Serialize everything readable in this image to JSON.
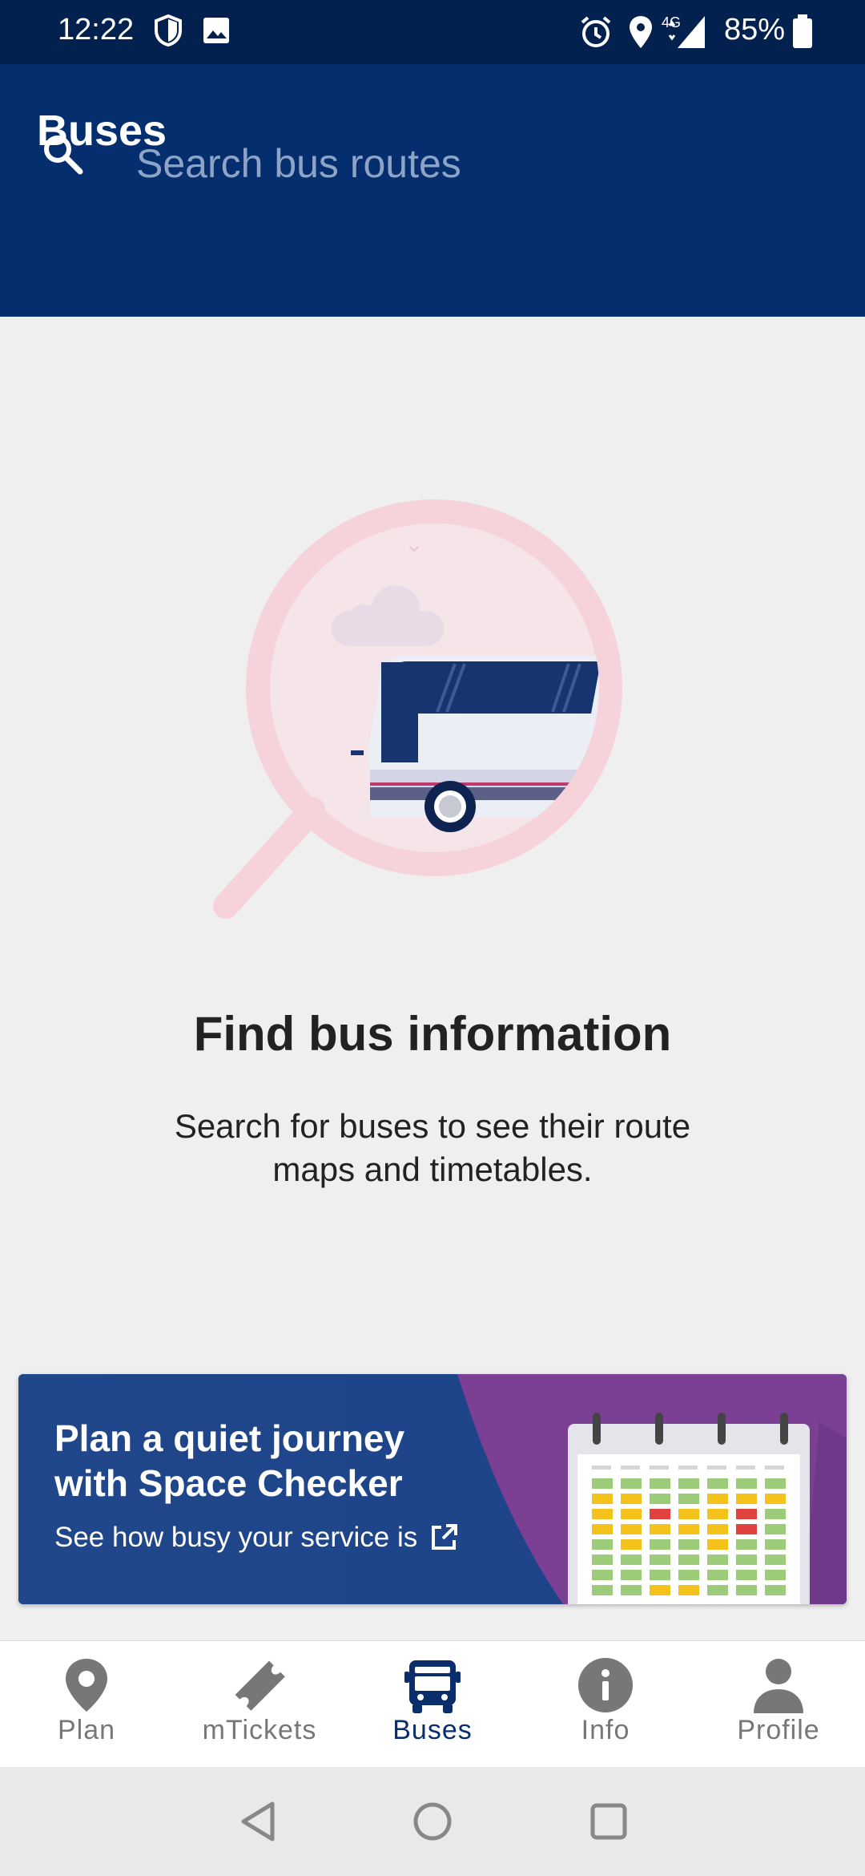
{
  "status_bar": {
    "time": "12:22",
    "battery": "85%",
    "network": "4G",
    "left_icons": [
      "shield-icon",
      "image-icon"
    ],
    "right_icons": [
      "alarm-icon",
      "location-icon",
      "signal-icon",
      "battery-icon"
    ]
  },
  "app_bar": {
    "title": "Buses",
    "search_placeholder": "Search bus routes"
  },
  "empty_state": {
    "title": "Find bus information",
    "description": "Search for buses to see their route maps and timetables."
  },
  "banner": {
    "title": "Plan a quiet journey with Space Checker",
    "link": "See how busy your service is"
  },
  "bottom_nav": {
    "items": [
      {
        "label": "Plan",
        "icon": "location-pin-icon"
      },
      {
        "label": "mTickets",
        "icon": "ticket-icon"
      },
      {
        "label": "Buses",
        "icon": "bus-icon",
        "active": true
      },
      {
        "label": "Info",
        "icon": "info-icon"
      },
      {
        "label": "Profile",
        "icon": "profile-icon"
      }
    ]
  },
  "colors": {
    "header": "#052e6e",
    "status_bar": "#03214f",
    "active_nav": "#0a2d6b",
    "banner_blue": "#1d4a8e",
    "banner_purple": "#7b3f94"
  }
}
